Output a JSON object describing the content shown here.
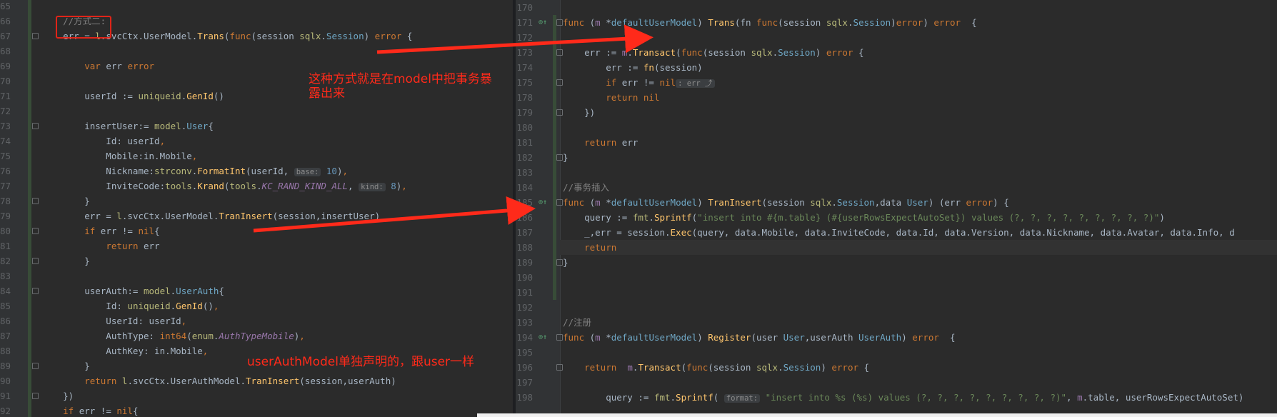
{
  "left_editor": {
    "lines": [
      {
        "ln": "65",
        "html": ""
      },
      {
        "ln": "66",
        "html": "<span class='cm'>    //方式二:</span>"
      },
      {
        "ln": "67",
        "html": "    err = <span class='pk'>l</span>.svcCtx.UserModel.<span class='fn'>Trans</span>(<span class='kw'>func</span>(session <span class='pk'>sqlx</span>.<span class='ty'>Session</span>) <span class='kw'>error</span> {"
      },
      {
        "ln": "68",
        "html": ""
      },
      {
        "ln": "69",
        "html": "        <span class='kw'>var</span> err <span class='kw'>error</span>"
      },
      {
        "ln": "70",
        "html": ""
      },
      {
        "ln": "71",
        "html": "        userId := <span class='pk'>uniqueid</span>.<span class='fn'>GenId</span>()"
      },
      {
        "ln": "72",
        "html": ""
      },
      {
        "ln": "73",
        "html": "        insertUser:= <span class='pk'>model</span>.<span class='ty'>User</span>{"
      },
      {
        "ln": "74",
        "html": "            Id: userId<span class='kw'>,</span>"
      },
      {
        "ln": "75",
        "html": "            Mobile:in.Mobile<span class='kw'>,</span>"
      },
      {
        "ln": "76",
        "html": "            Nickname:<span class='pk'>strconv</span>.<span class='fn'>FormatInt</span>(userId, <span class='hint'>base:</span> <span class='nu'>10</span>)<span class='kw'>,</span>"
      },
      {
        "ln": "77",
        "html": "            InviteCode:<span class='pk'>tools</span>.<span class='fn'>Krand</span>(<span class='pk'>tools</span>.<span class='cn'>KC_RAND_KIND_ALL</span>, <span class='hint'>kind:</span> <span class='nu'>8</span>)<span class='kw'>,</span>"
      },
      {
        "ln": "78",
        "html": "        }"
      },
      {
        "ln": "79",
        "html": "        err = <span class='pk'>l</span>.svcCtx.UserModel.<span class='fn'>TranInsert</span>(session,insertUser)"
      },
      {
        "ln": "80",
        "html": "        <span class='kw'>if</span> err != <span class='kw'>nil</span>{"
      },
      {
        "ln": "81",
        "html": "            <span class='kw'>return</span> err"
      },
      {
        "ln": "82",
        "html": "        }"
      },
      {
        "ln": "83",
        "html": ""
      },
      {
        "ln": "84",
        "html": "        userAuth:= <span class='pk'>model</span>.<span class='ty'>UserAuth</span>{"
      },
      {
        "ln": "85",
        "html": "            Id: <span class='pk'>uniqueid</span>.<span class='fn'>GenId</span>()<span class='kw'>,</span>"
      },
      {
        "ln": "86",
        "html": "            UserId: userId<span class='kw'>,</span>"
      },
      {
        "ln": "87",
        "html": "            AuthType: <span class='kw'>int64</span>(<span class='pk'>enum</span>.<span class='cn'>AuthTypeMobile</span>)<span class='kw'>,</span>"
      },
      {
        "ln": "88",
        "html": "            AuthKey: in.Mobile<span class='kw'>,</span>"
      },
      {
        "ln": "89",
        "html": "        }"
      },
      {
        "ln": "90",
        "html": "        <span class='kw'>return</span> <span class='pk'>l</span>.svcCtx.UserAuthModel.<span class='fn'>TranInsert</span>(session,userAuth)"
      },
      {
        "ln": "91",
        "html": "    })"
      },
      {
        "ln": "92",
        "html": "    <span class='kw'>if</span> err != <span class='kw'>nil</span>{"
      }
    ]
  },
  "right_editor": {
    "lines": [
      {
        "ln": "170",
        "html": ""
      },
      {
        "ln": "171",
        "html": "<span class='kw'>func</span> (<span class='rv'>m</span> *<span class='ty'>defaultUserModel</span>) <span class='fn'>Trans</span>(fn <span class='kw'>func</span>(session <span class='pk'>sqlx</span>.<span class='ty'>Session</span>)<span class='kw'>error</span>) <span class='kw'>error</span>  {"
      },
      {
        "ln": "172",
        "html": ""
      },
      {
        "ln": "173",
        "html": "    err := <span class='rv'>m</span>.<span class='fn'>Transact</span>(<span class='kw'>func</span>(session <span class='pk'>sqlx</span>.<span class='ty'>Session</span>) <span class='kw'>error</span> {"
      },
      {
        "ln": "174",
        "html": "        err := <span class='fn'>fn</span>(session)"
      },
      {
        "ln": "175",
        "html": "        <span class='kw'>if</span> err != <span class='kw'>nil</span><span class='hint'>: err ⤴</span>"
      },
      {
        "ln": "178",
        "html": "        <span class='kw'>return</span> <span class='kw'>nil</span>"
      },
      {
        "ln": "179",
        "html": "    })"
      },
      {
        "ln": "180",
        "html": ""
      },
      {
        "ln": "181",
        "html": "    <span class='kw'>return</span> err"
      },
      {
        "ln": "182",
        "html": "}"
      },
      {
        "ln": "183",
        "html": ""
      },
      {
        "ln": "184",
        "html": "<span class='cm'>//事务插入</span>"
      },
      {
        "ln": "185",
        "html": "<span class='kw'>func</span> (<span class='rv'>m</span> *<span class='ty'>defaultUserModel</span>) <span class='fn'>TranInsert</span>(session <span class='pk'>sqlx</span>.<span class='ty'>Session</span>,data <span class='ty'>User</span>) (err <span class='kw'>error</span>) {"
      },
      {
        "ln": "186",
        "html": "    query := <span class='pk'>fmt</span>.<span class='fn'>Sprintf</span>(<span class='st'>\"insert into #{m.table} (#{userRowsExpectAutoSet}) values (?, ?, ?, ?, ?, ?, ?, ?, ?)\"</span>)"
      },
      {
        "ln": "187",
        "html": "    _,err = session.<span class='fn'>Exec</span>(query, data.Mobile, data.InviteCode, data.Id, data.Version, data.Nickname, data.Avatar, data.Info, d"
      },
      {
        "ln": "188",
        "html": "    <span class='kw'>return</span>"
      },
      {
        "ln": "189",
        "html": "}"
      },
      {
        "ln": "190",
        "html": ""
      },
      {
        "ln": "191",
        "html": ""
      },
      {
        "ln": "192",
        "html": ""
      },
      {
        "ln": "193",
        "html": "<span class='cm'>//注册</span>"
      },
      {
        "ln": "194",
        "html": "<span class='kw'>func</span> (<span class='rv'>m</span> *<span class='ty'>defaultUserModel</span>) <span class='fn'>Register</span>(user <span class='ty'>User</span>,userAuth <span class='ty'>UserAuth</span>) <span class='kw'>error</span>  {"
      },
      {
        "ln": "195",
        "html": ""
      },
      {
        "ln": "196",
        "html": "    <span class='kw'>return</span>  <span class='rv'>m</span>.<span class='fn'>Transact</span>(<span class='kw'>func</span>(session <span class='pk'>sqlx</span>.<span class='ty'>Session</span>) <span class='kw'>error</span> {"
      },
      {
        "ln": "197",
        "html": ""
      },
      {
        "ln": "198",
        "html": "        query := <span class='pk'>fmt</span>.<span class='fn'>Sprintf</span>( <span class='hint'>format:</span> <span class='st'>\"insert into %s (%s) values (?, ?, ?, ?, ?, ?, ?, ?, ?)\"</span>, <span class='rv'>m</span>.table, userRowsExpectAutoSet)"
      }
    ]
  },
  "annotations": {
    "note_expose": "这种方式就是在model中把事务暴露出来",
    "note_userauth": "userAuthModel单独声明的，跟user一样"
  },
  "colors": {
    "background": "#2b2b2b",
    "annotation_red": "#ff2a1a",
    "keyword": "#cc7832",
    "function": "#ffc66d"
  }
}
